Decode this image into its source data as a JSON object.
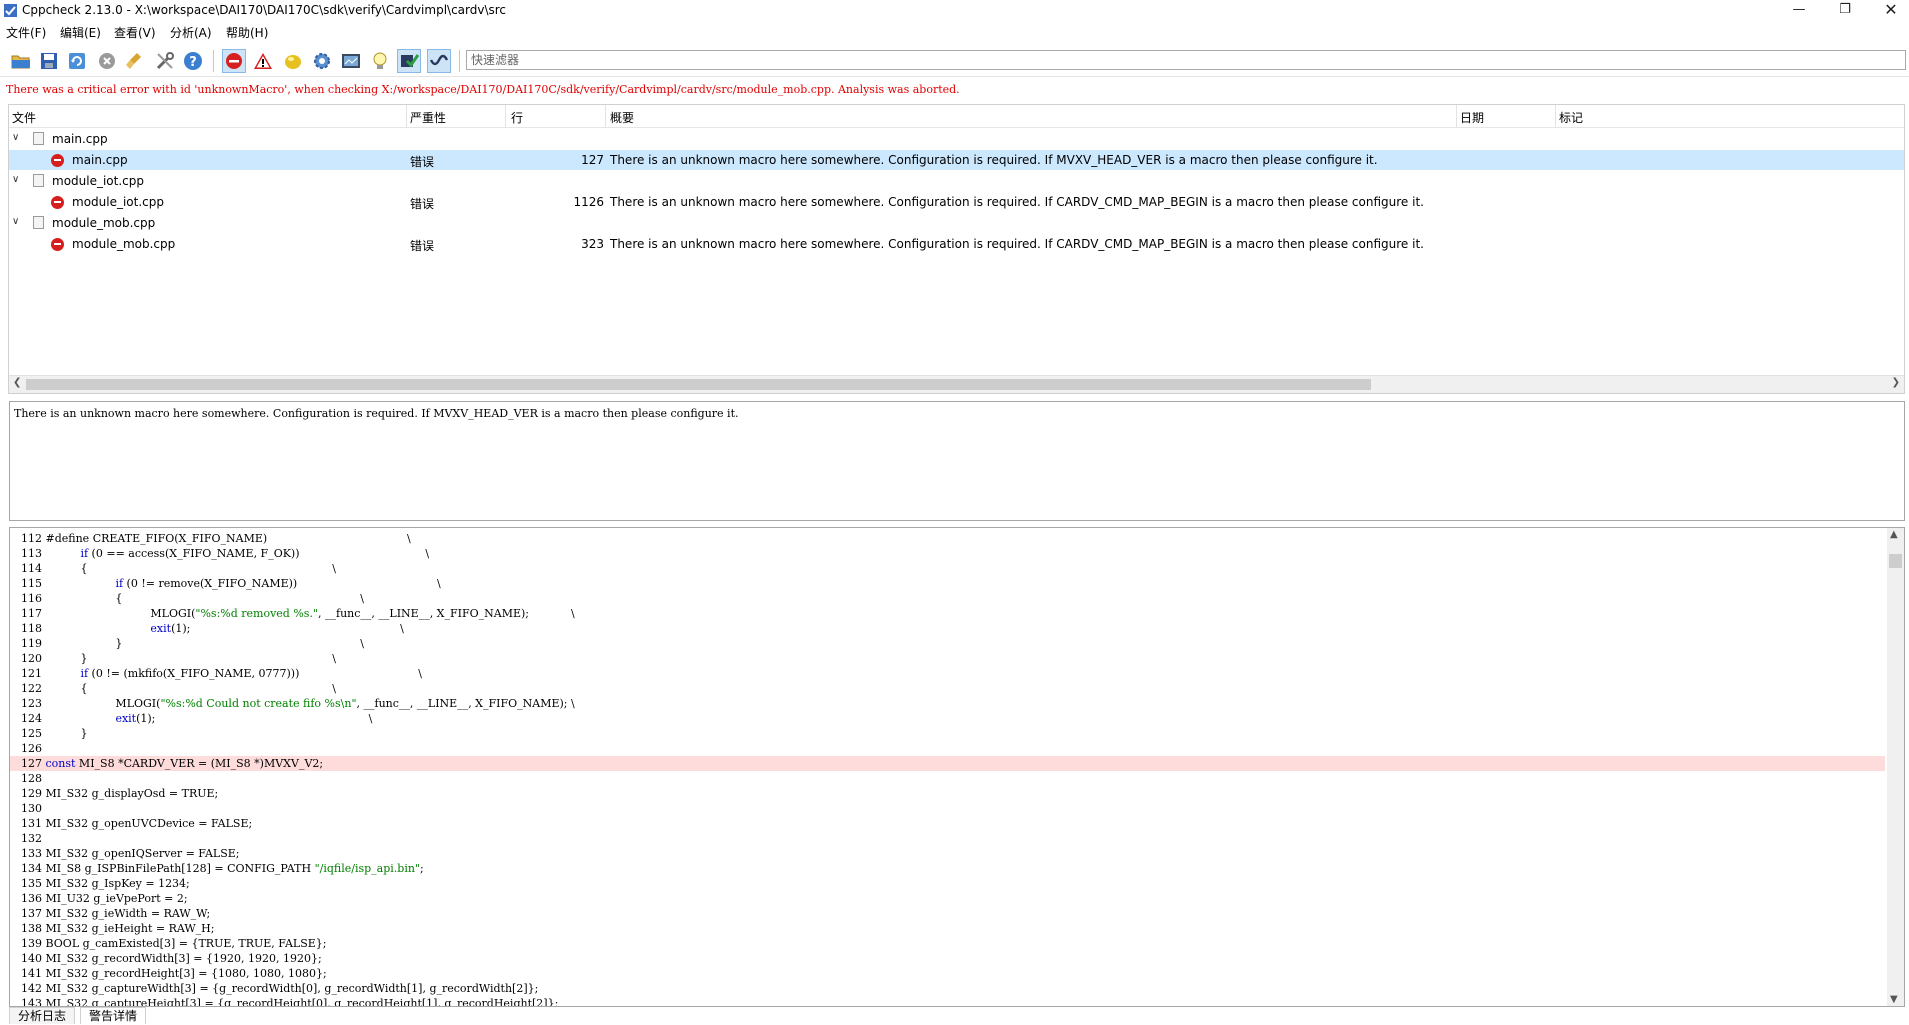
{
  "window": {
    "title": "Cppcheck 2.13.0 - X:\\workspace\\DAI170\\DAI170C\\sdk\\verify\\Cardvimpl\\cardv\\src",
    "min_glyph": "—",
    "max_glyph": "❐",
    "close_glyph": "✕"
  },
  "menu": [
    "文件(F)",
    "编辑(E)",
    "查看(V)",
    "分析(A)",
    "帮助(H)"
  ],
  "toolbar": {
    "buttons": [
      {
        "name": "open-folder-icon"
      },
      {
        "name": "save-icon"
      },
      {
        "name": "refresh-icon"
      },
      {
        "name": "stop-icon"
      },
      {
        "name": "clear-broom-icon"
      },
      {
        "name": "settings-tools-icon"
      },
      {
        "name": "help-icon"
      },
      {
        "name": "show-errors-icon"
      },
      {
        "name": "show-warnings-icon"
      },
      {
        "name": "show-style-icon"
      },
      {
        "name": "show-performance-icon"
      },
      {
        "name": "show-portability-icon"
      },
      {
        "name": "show-information-icon"
      },
      {
        "name": "cert-checks-icon"
      },
      {
        "name": "wave-icon"
      }
    ],
    "filter_placeholder": "快速滤器"
  },
  "critical_error": "There was a critical error with id 'unknownMacro', when checking X:/workspace/DAI170/DAI170C/sdk/verify/Cardvimpl/cardv/src/module_mob.cpp. Analysis was aborted.",
  "results": {
    "columns": [
      "文件",
      "严重性",
      "行",
      "概要",
      "日期",
      "标记"
    ],
    "groups": [
      {
        "file": "main.cpp",
        "child": {
          "file": "main.cpp",
          "severity": "错误",
          "line": "127",
          "summary": "There is an unknown macro here somewhere. Configuration is required. If MVXV_HEAD_VER is a macro then please configure it."
        }
      },
      {
        "file": "module_iot.cpp",
        "child": {
          "file": "module_iot.cpp",
          "severity": "错误",
          "line": "1126",
          "summary": "There is an unknown macro here somewhere. Configuration is required. If CARDV_CMD_MAP_BEGIN is a macro then please configure it."
        }
      },
      {
        "file": "module_mob.cpp",
        "child": {
          "file": "module_mob.cpp",
          "severity": "错误",
          "line": "323",
          "summary": "There is an unknown macro here somewhere. Configuration is required. If CARDV_CMD_MAP_BEGIN is a macro then please configure it."
        }
      }
    ]
  },
  "details_text": "There is an unknown macro here somewhere. Configuration is required. If MVXV_HEAD_VER is a macro then please configure it.",
  "code": {
    "highlight_line": "127",
    "lines": [
      {
        "n": "112",
        "t": "#define CREATE_FIFO(X_FIFO_NAME)                                        \\"
      },
      {
        "n": "113",
        "t": "          if (0 == access(X_FIFO_NAME, F_OK))                                    \\"
      },
      {
        "n": "114",
        "t": "          {                                                                      \\"
      },
      {
        "n": "115",
        "t": "                    if (0 != remove(X_FIFO_NAME))                                        \\"
      },
      {
        "n": "116",
        "t": "                    {                                                                    \\"
      },
      {
        "n": "117",
        "t": "                              MLOGI(\"%s:%d removed %s.\", __func__, __LINE__, X_FIFO_NAME);            \\"
      },
      {
        "n": "118",
        "t": "                              exit(1);                                                            \\"
      },
      {
        "n": "119",
        "t": "                    }                                                                    \\"
      },
      {
        "n": "120",
        "t": "          }                                                                      \\"
      },
      {
        "n": "121",
        "t": "          if (0 != (mkfifo(X_FIFO_NAME, 0777)))                                  \\"
      },
      {
        "n": "122",
        "t": "          {                                                                      \\"
      },
      {
        "n": "123",
        "t": "                    MLOGI(\"%s:%d Could not create fifo %s\\n\", __func__, __LINE__, X_FIFO_NAME); \\"
      },
      {
        "n": "124",
        "t": "                    exit(1);                                                             \\"
      },
      {
        "n": "125",
        "t": "          }"
      },
      {
        "n": "126",
        "t": ""
      },
      {
        "n": "127",
        "t": "const MI_S8 *CARDV_VER = (MI_S8 *)MVXV_V2;"
      },
      {
        "n": "128",
        "t": ""
      },
      {
        "n": "129",
        "t": "MI_S32 g_displayOsd = TRUE;"
      },
      {
        "n": "130",
        "t": ""
      },
      {
        "n": "131",
        "t": "MI_S32 g_openUVCDevice = FALSE;"
      },
      {
        "n": "132",
        "t": ""
      },
      {
        "n": "133",
        "t": "MI_S32 g_openIQServer = FALSE;"
      },
      {
        "n": "134",
        "t": "MI_S8 g_ISPBinFilePath[128] = CONFIG_PATH \"/iqfile/isp_api.bin\";"
      },
      {
        "n": "135",
        "t": "MI_S32 g_IspKey = 1234;"
      },
      {
        "n": "136",
        "t": "MI_U32 g_ieVpePort = 2;"
      },
      {
        "n": "137",
        "t": "MI_S32 g_ieWidth = RAW_W;"
      },
      {
        "n": "138",
        "t": "MI_S32 g_ieHeight = RAW_H;"
      },
      {
        "n": "139",
        "t": "BOOL g_camExisted[3] = {TRUE, TRUE, FALSE};"
      },
      {
        "n": "140",
        "t": "MI_S32 g_recordWidth[3] = {1920, 1920, 1920};"
      },
      {
        "n": "141",
        "t": "MI_S32 g_recordHeight[3] = {1080, 1080, 1080};"
      },
      {
        "n": "142",
        "t": "MI_S32 g_captureWidth[3] = {g_recordWidth[0], g_recordWidth[1], g_recordWidth[2]};"
      },
      {
        "n": "143",
        "t": "MI_S32 g_captureHeight[3] = {g_recordHeight[0], g_recordHeight[1], g_recordHeight[2]};"
      }
    ]
  },
  "tabs": [
    "分析日志",
    "警告详情"
  ],
  "colors": {
    "critical_error": "#e00000",
    "selection": "#cce8ff",
    "highlight_line": "#ffdcdc",
    "keyword": "#0000c8",
    "string": "#008000"
  }
}
